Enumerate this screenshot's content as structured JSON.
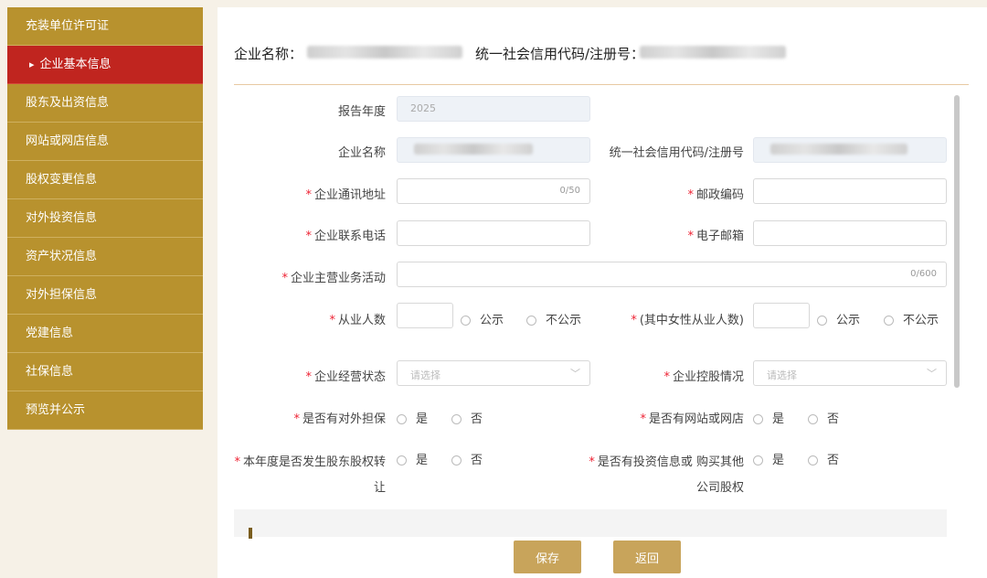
{
  "sidebar": {
    "items": [
      {
        "label": "充装单位许可证",
        "active": false
      },
      {
        "label": "企业基本信息",
        "active": true
      },
      {
        "label": "股东及出资信息",
        "active": false
      },
      {
        "label": "网站或网店信息",
        "active": false
      },
      {
        "label": "股权变更信息",
        "active": false
      },
      {
        "label": "对外投资信息",
        "active": false
      },
      {
        "label": "资产状况信息",
        "active": false
      },
      {
        "label": "对外担保信息",
        "active": false
      },
      {
        "label": "党建信息",
        "active": false
      },
      {
        "label": "社保信息",
        "active": false
      },
      {
        "label": "预览并公示",
        "active": false
      }
    ]
  },
  "header": {
    "company_label": "企业名称：",
    "credit_label": "统一社会信用代码/注册号："
  },
  "form": {
    "report_year_label": "报告年度",
    "report_year_value": "2025",
    "company_name_label": "企业名称",
    "credit_code_label": "统一社会信用代码/注册号",
    "address_label": "企业通讯地址",
    "address_counter": "0/50",
    "postal_label": "邮政编码",
    "phone_label": "企业联系电话",
    "email_label": "电子邮箱",
    "business_label": "企业主营业务活动",
    "business_counter": "0/600",
    "employees_label": "从业人数",
    "female_label": "(其中女性从业人数)",
    "public_label": "公示",
    "not_public_label": "不公示",
    "status_label": "企业经营状态",
    "holding_label": "企业控股情况",
    "select_placeholder": "请选择",
    "guarantee_label": "是否有对外担保",
    "website_label": "是否有网站或网店",
    "transfer_label_1": "本年度是否发生股东股权转",
    "transfer_label_2": "让",
    "invest_label_1": "是否有投资信息或 购买其他",
    "invest_label_2": "公司股权",
    "yes_label": "是",
    "no_label": "否",
    "required_mark": "*"
  },
  "buttons": {
    "save": "保存",
    "back": "返回"
  },
  "colors": {
    "sidebar": "#b8922e",
    "active": "#c0251f",
    "button": "#c8a45b"
  }
}
